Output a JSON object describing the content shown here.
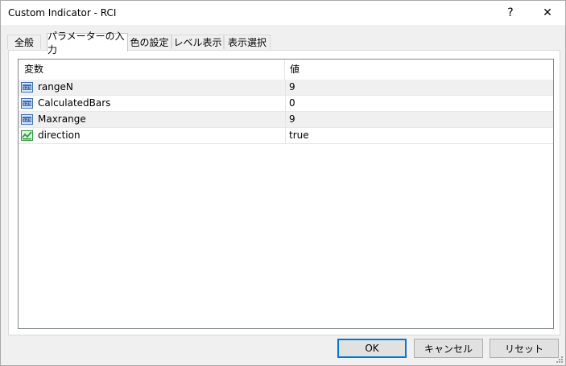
{
  "window": {
    "title": "Custom Indicator - RCI",
    "help_glyph": "?",
    "close_glyph": "✕"
  },
  "tabs": [
    {
      "label": "全般"
    },
    {
      "label": "パラメーターの入力"
    },
    {
      "label": "色の設定"
    },
    {
      "label": "レベル表示"
    },
    {
      "label": "表示選択"
    }
  ],
  "active_tab": 1,
  "grid": {
    "columns": {
      "name": "変数",
      "value": "値"
    },
    "rows": [
      {
        "name": "rangeN",
        "value": "9",
        "icon": "integer-icon"
      },
      {
        "name": "CalculatedBars",
        "value": "0",
        "icon": "integer-icon"
      },
      {
        "name": "Maxrange",
        "value": "9",
        "icon": "integer-icon"
      },
      {
        "name": "direction",
        "value": "true",
        "icon": "boolean-icon"
      }
    ]
  },
  "buttons": {
    "ok": "OK",
    "cancel": "キャンセル",
    "reset": "リセット"
  },
  "colors": {
    "accent": "#0078d7",
    "int_icon": "#3c6fb4",
    "bool_icon": "#2e9b3c"
  }
}
